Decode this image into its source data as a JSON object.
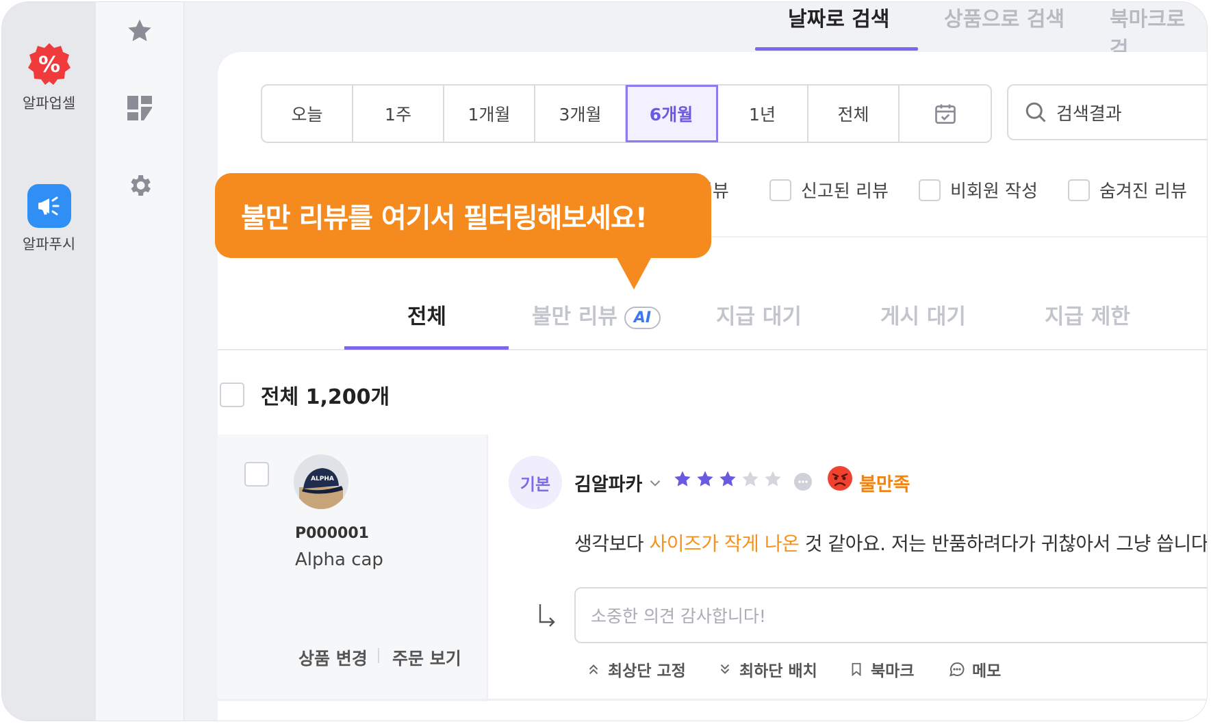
{
  "apps": [
    {
      "label": "알파업셀",
      "icon": "percent-badge-icon"
    },
    {
      "label": "알파푸시",
      "icon": "megaphone-icon"
    }
  ],
  "side_icons": [
    "star-icon",
    "dashboard-icon",
    "gear-icon"
  ],
  "top_tabs": [
    {
      "label": "날짜로 검색",
      "active": true
    },
    {
      "label": "상품으로 검색",
      "active": false
    },
    {
      "label": "북마크로 검",
      "active": false
    }
  ],
  "period": {
    "options": [
      "오늘",
      "1주",
      "1개월",
      "3개월",
      "6개월",
      "1년",
      "전체"
    ],
    "selected": "6개월",
    "calendar_icon": "calendar-icon"
  },
  "search": {
    "placeholder": "검색결과"
  },
  "filters": [
    {
      "label": "리뷰",
      "checked": false
    },
    {
      "label": "신고된 리뷰",
      "checked": false
    },
    {
      "label": "비회원 작성",
      "checked": false
    },
    {
      "label": "숨겨진 리뷰",
      "checked": false
    }
  ],
  "tooltip": {
    "text": "불만 리뷰를 여기서 필터링해보세요!"
  },
  "review_tabs": [
    {
      "label": "전체",
      "active": true
    },
    {
      "label": "불만 리뷰",
      "badge": "AI",
      "active": false
    },
    {
      "label": "지급 대기",
      "active": false
    },
    {
      "label": "게시 대기",
      "active": false
    },
    {
      "label": "지급 제한",
      "active": false
    }
  ],
  "total": {
    "label": "전체 1,200개"
  },
  "product": {
    "code": "P000001",
    "name": "Alpha cap",
    "cap_text": "ALPHA",
    "links": [
      "상품 변경",
      "주문 보기"
    ]
  },
  "review": {
    "type_badge": "기본",
    "author": "김알파카",
    "rating": 3,
    "max_rating": 5,
    "sentiment": "불만족",
    "text_before": "생각보다 ",
    "text_highlight": "사이즈가 작게 나온",
    "text_after": " 것 같아요. 저는 반품하려다가 귀찮아서 그냥 씁니다",
    "reply_placeholder": "소중한 의견 감사합니다!",
    "actions": [
      {
        "label": "최상단 고정",
        "icon": "double-chevron-up-icon"
      },
      {
        "label": "최하단 배치",
        "icon": "double-chevron-down-icon"
      },
      {
        "label": "북마크",
        "icon": "bookmark-icon"
      },
      {
        "label": "메모",
        "icon": "comment-icon"
      }
    ]
  },
  "colors": {
    "accent": "#7b68ee",
    "tooltip": "#f58b1f",
    "sentiment": "#f5820d",
    "star": "#6a5ae0"
  }
}
